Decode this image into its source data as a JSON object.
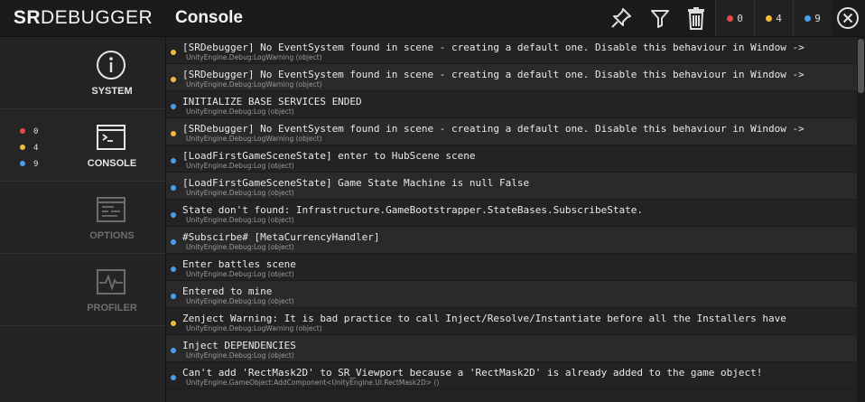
{
  "app": {
    "logo_bold": "SR",
    "logo_rest": "DEBUGGER",
    "title": "Console"
  },
  "toolbar": {
    "error_count": "0",
    "warning_count": "4",
    "info_count": "9"
  },
  "colors": {
    "error": "#e84848",
    "warning": "#f5b93b",
    "info": "#4a9ef0"
  },
  "sidebar": {
    "items": [
      {
        "label": "SYSTEM",
        "icon": "info-icon"
      },
      {
        "label": "CONSOLE",
        "icon": "console-icon"
      },
      {
        "label": "OPTIONS",
        "icon": "options-icon"
      },
      {
        "label": "PROFILER",
        "icon": "profiler-icon"
      }
    ],
    "counts": {
      "error": "0",
      "warning": "4",
      "info": "9"
    }
  },
  "log": [
    {
      "level": "warning",
      "message": "[SRDebugger] No EventSystem found in scene - creating a default one. Disable this behaviour in Window ->",
      "source": "UnityEngine.Debug:LogWarning (object)"
    },
    {
      "level": "warning",
      "message": "[SRDebugger] No EventSystem found in scene - creating a default one. Disable this behaviour in Window ->",
      "source": "UnityEngine.Debug:LogWarning (object)"
    },
    {
      "level": "info",
      "message": "INITIALIZE BASE SERVICES ENDED",
      "source": "UnityEngine.Debug:Log (object)"
    },
    {
      "level": "warning",
      "message": "[SRDebugger] No EventSystem found in scene - creating a default one. Disable this behaviour in Window ->",
      "source": "UnityEngine.Debug:LogWarning (object)"
    },
    {
      "level": "info",
      "message": "[LoadFirstGameSceneState] enter to HubScene scene",
      "source": "UnityEngine.Debug:Log (object)"
    },
    {
      "level": "info",
      "message": "[LoadFirstGameSceneState] Game State Machine is null False",
      "source": "UnityEngine.Debug:Log (object)"
    },
    {
      "level": "info",
      "message": "State don't found: Infrastructure.GameBootstrapper.StateBases.SubscribeState.",
      "source": "UnityEngine.Debug:Log (object)"
    },
    {
      "level": "info",
      "message": "#Subscirbe# [MetaCurrencyHandler]",
      "source": "UnityEngine.Debug:Log (object)"
    },
    {
      "level": "info",
      "message": "Enter battles scene",
      "source": "UnityEngine.Debug:Log (object)"
    },
    {
      "level": "info",
      "message": "Entered to mine",
      "source": "UnityEngine.Debug:Log (object)"
    },
    {
      "level": "warning",
      "message": "Zenject Warning: It is bad practice to call Inject/Resolve/Instantiate before all the Installers have",
      "source": "UnityEngine.Debug:LogWarning (object)"
    },
    {
      "level": "info",
      "message": "Inject DEPENDENCIES",
      "source": "UnityEngine.Debug:Log (object)"
    },
    {
      "level": "info",
      "message": "Can't add 'RectMask2D' to SR_Viewport because a 'RectMask2D' is already added to the game object!",
      "source": "UnityEngine.GameObject:AddComponent<UnityEngine.UI.RectMask2D> ()"
    }
  ]
}
